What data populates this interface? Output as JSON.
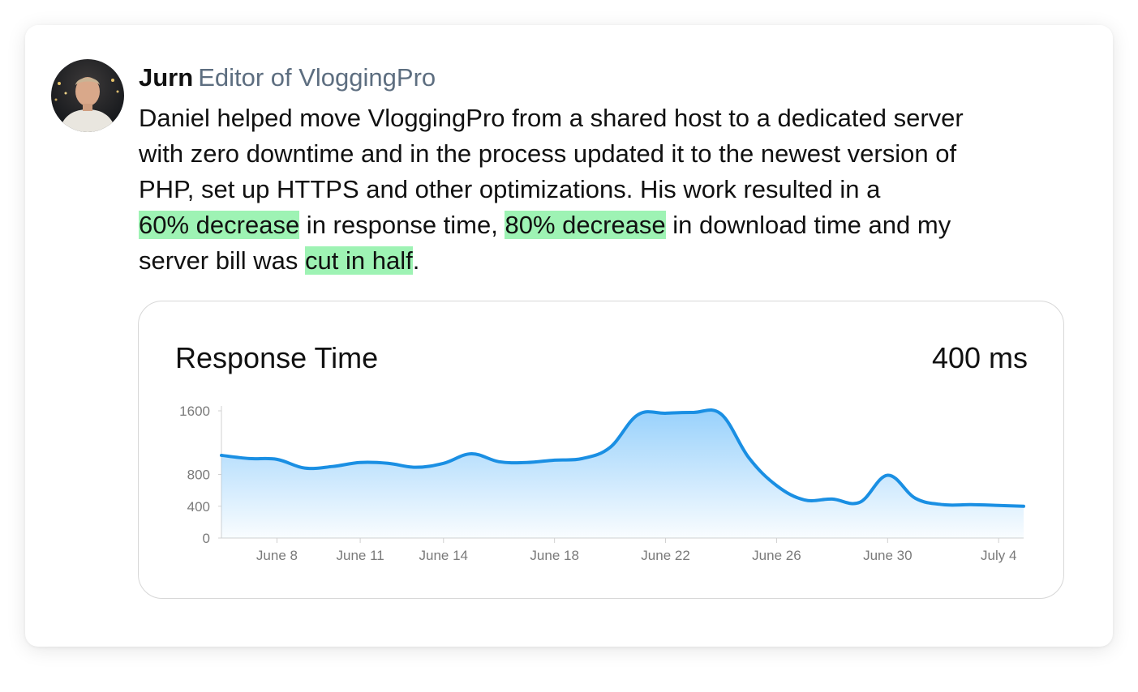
{
  "testimonial": {
    "author_name": "Jurn",
    "author_role": "Editor of VloggingPro",
    "quote_lines": [
      [
        {
          "text": "Daniel helped move VloggingPro from a shared host to a dedicated server",
          "hl": false
        }
      ],
      [
        {
          "text": "with zero downtime and in the process updated it to the newest version of",
          "hl": false
        }
      ],
      [
        {
          "text": "PHP, set up HTTPS and other optimizations. His work resulted in a",
          "hl": false
        }
      ],
      [
        {
          "text": "60% decrease",
          "hl": true
        },
        {
          "text": " in response time, ",
          "hl": false
        },
        {
          "text": "80% decrease",
          "hl": true
        },
        {
          "text": " in download time and my",
          "hl": false
        }
      ],
      [
        {
          "text": "server bill was ",
          "hl": false
        },
        {
          "text": "cut in half",
          "hl": true
        },
        {
          "text": ".",
          "hl": false
        }
      ]
    ],
    "highlight_color": "#9ef3b4"
  },
  "chart_data": {
    "type": "area",
    "title": "Response Time",
    "headline_value": "400 ms",
    "y_ticks": [
      0,
      400,
      800,
      1600
    ],
    "ylim": [
      0,
      1600
    ],
    "x_ticks": [
      "June 8",
      "June 11",
      "June 14",
      "June 18",
      "June 22",
      "June 26",
      "June 30",
      "July 4"
    ],
    "x_tick_days": [
      8,
      11,
      14,
      18,
      22,
      26,
      30,
      34
    ],
    "xlim": [
      6,
      34.9
    ],
    "series": [
      {
        "x": [
          6,
          7,
          8,
          9,
          10,
          11,
          12,
          13,
          14,
          15,
          16,
          17,
          18,
          19,
          20,
          21,
          22,
          23,
          24,
          25,
          26,
          27,
          28,
          29,
          30,
          31,
          32,
          33,
          34,
          34.9
        ],
        "values": [
          1040,
          1000,
          990,
          880,
          900,
          950,
          940,
          890,
          940,
          1060,
          960,
          950,
          980,
          1000,
          1140,
          1550,
          1570,
          1580,
          1560,
          1010,
          660,
          480,
          490,
          450,
          790,
          500,
          420,
          420,
          410,
          400
        ]
      }
    ],
    "line_color": "#1a8fe3",
    "fill_color_top": "#8dccfb",
    "grid": false
  }
}
